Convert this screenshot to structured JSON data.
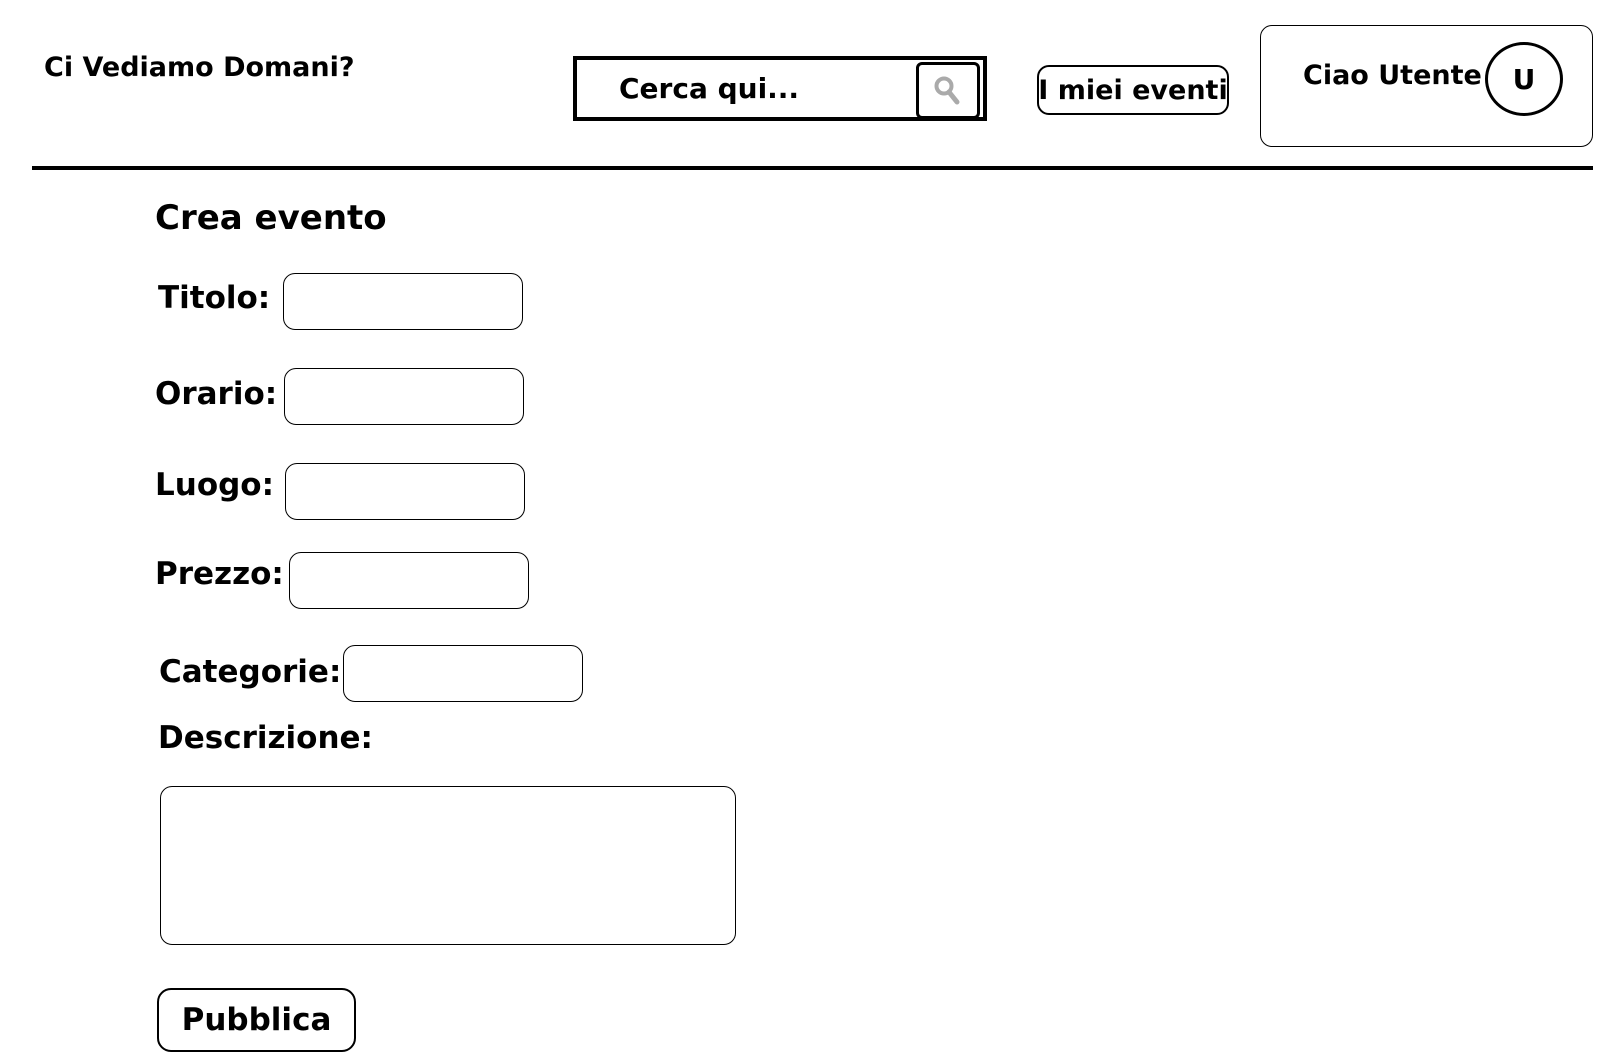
{
  "header": {
    "brand": "Ci Vediamo Domani?",
    "search": {
      "placeholder": "Cerca qui...",
      "button_icon": "search-icon"
    },
    "my_events_label": "I miei eventi",
    "user": {
      "greeting": "Ciao Utente",
      "avatar_initial": "U"
    }
  },
  "form": {
    "title": "Crea evento",
    "fields": {
      "titolo": {
        "label": "Titolo:",
        "value": ""
      },
      "orario": {
        "label": "Orario:",
        "value": ""
      },
      "luogo": {
        "label": "Luogo:",
        "value": ""
      },
      "prezzo": {
        "label": "Prezzo:",
        "value": ""
      },
      "categorie": {
        "label": "Categorie:",
        "value": ""
      },
      "descrizione": {
        "label": "Descrizione:",
        "value": ""
      }
    },
    "submit_label": "Pubblica"
  }
}
